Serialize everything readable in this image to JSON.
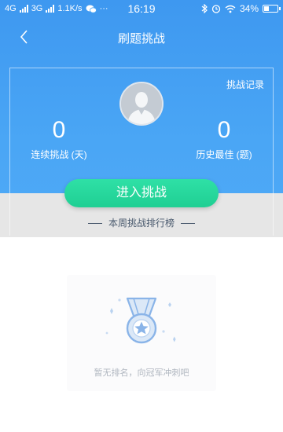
{
  "status_bar": {
    "network_1": "4G",
    "network_2": "3G",
    "speed": "1.1K/s",
    "more": "···",
    "time": "16:19",
    "battery": "34%",
    "battery_level": 0.34
  },
  "navbar": {
    "title": "刷题挑战",
    "back_icon": "chevron-left-icon"
  },
  "header": {
    "record_link": "挑战记录",
    "streak_value": "0",
    "streak_label": "连续挑战 (天)",
    "best_value": "0",
    "best_label": "历史最佳 (题)"
  },
  "actions": {
    "enter_label": "进入挑战"
  },
  "ranking": {
    "title": "本周挑战排行榜",
    "empty_text": "暂无排名，向冠军冲刺吧"
  },
  "colors": {
    "header_blue": "#4aa6f5",
    "button_green": "#26d69a",
    "band_gray": "#e6e6e6",
    "medal_blue": "#8ab4e8"
  }
}
